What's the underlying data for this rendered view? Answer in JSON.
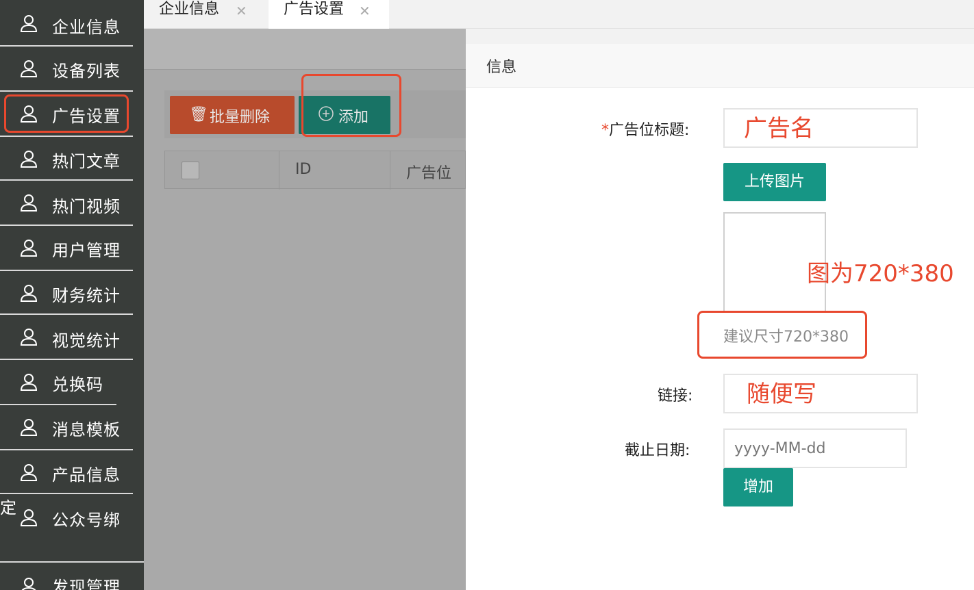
{
  "sidebar": {
    "items": [
      {
        "label": "企业信息"
      },
      {
        "label": "设备列表"
      },
      {
        "label": "广告设置"
      },
      {
        "label": "热门文章"
      },
      {
        "label": "热门视频"
      },
      {
        "label": "用户管理"
      },
      {
        "label": "财务统计"
      },
      {
        "label": "视觉统计"
      },
      {
        "label": "兑换码"
      },
      {
        "label": "消息模板"
      },
      {
        "label": "产品信息"
      },
      {
        "label": "公众号绑"
      },
      {
        "label": "发现管理"
      }
    ],
    "wrap_tail": "定",
    "active_index": 2
  },
  "tabs": [
    {
      "label": "企业信息"
    },
    {
      "label": "广告设置"
    }
  ],
  "toolbar": {
    "delete_label": "批量删除",
    "add_label": "添加"
  },
  "grid": {
    "columns": [
      "ID",
      "广告位"
    ]
  },
  "dialog": {
    "title": "信息",
    "title_field_label": "广告位标题:",
    "required_mark": "*",
    "upload_label": "上传图片",
    "size_hint": "建议尺寸720*380",
    "link_label": "链接:",
    "deadline_label": "截止日期:",
    "deadline_placeholder": "yyyy-MM-dd",
    "submit_label": "增加"
  },
  "annotations": {
    "title_note": "广告名",
    "image_note": "图为720*380",
    "link_note": "随便写"
  },
  "colors": {
    "sidebar_bg": "#393d3a",
    "highlight": "#e8482e",
    "primary": "#169685",
    "danger": "#b84b2c"
  }
}
